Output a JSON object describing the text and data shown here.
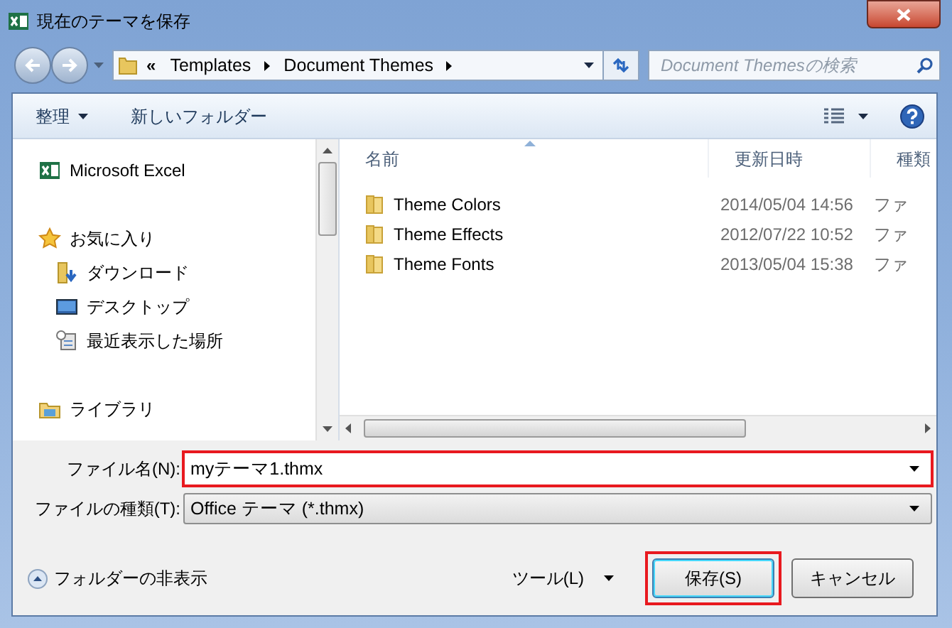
{
  "window": {
    "title": "現在のテーマを保存"
  },
  "address_bar": {
    "overflow": "«",
    "segments": [
      "Templates",
      "Document Themes"
    ]
  },
  "search": {
    "placeholder": "Document Themesの検索"
  },
  "toolbar": {
    "organize": "整理",
    "new_folder": "新しいフォルダー"
  },
  "navigation": [
    {
      "kind": "excel",
      "label": "Microsoft Excel"
    },
    {
      "kind": "favorites",
      "label": "お気に入り",
      "children": [
        {
          "kind": "downloads",
          "label": "ダウンロード"
        },
        {
          "kind": "desktop",
          "label": "デスクトップ"
        },
        {
          "kind": "recent",
          "label": "最近表示した場所"
        }
      ]
    },
    {
      "kind": "library",
      "label": "ライブラリ"
    }
  ],
  "columns": [
    {
      "label": "名前",
      "sorted": true
    },
    {
      "label": "更新日時",
      "sorted": false
    },
    {
      "label": "種類",
      "sorted": false
    }
  ],
  "files": [
    {
      "name": "Theme Colors",
      "modified": "2014/05/04 14:56",
      "type": "ファ"
    },
    {
      "name": "Theme Effects",
      "modified": "2012/07/22 10:52",
      "type": "ファ"
    },
    {
      "name": "Theme Fonts",
      "modified": "2013/05/04 15:38",
      "type": "ファ"
    }
  ],
  "file_name": {
    "label": "ファイル名(N):",
    "value": "myテーマ1.thmx",
    "highlighted": true
  },
  "file_type": {
    "label": "ファイルの種類(T):",
    "value": "Office テーマ (*.thmx)"
  },
  "hide_folders": "フォルダーの非表示",
  "tools": "ツール(L)",
  "buttons": [
    {
      "label": "保存(S)",
      "default": true,
      "highlighted": true
    },
    {
      "label": "キャンセル",
      "default": false,
      "highlighted": false
    }
  ]
}
